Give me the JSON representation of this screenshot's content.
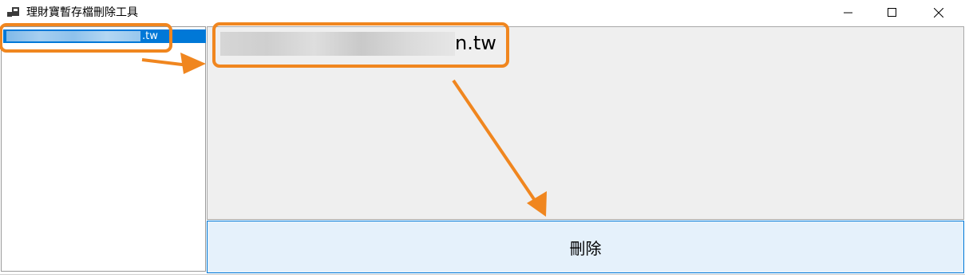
{
  "window": {
    "title": "理財寶暫存檔刪除工具",
    "app_icon": "app-icon",
    "controls": [
      "minimize-icon",
      "maximize-icon",
      "close-icon"
    ]
  },
  "list": {
    "items": [
      {
        "suffix": ".tw",
        "selected": true
      }
    ]
  },
  "panel": {
    "display_suffix": "n.tw"
  },
  "actions": {
    "delete_label": "刪除"
  },
  "colors": {
    "selection": "#0078d7",
    "annotation": "#f0861f",
    "button_bg": "#e5f1fb",
    "panel_bg": "#efefef"
  }
}
